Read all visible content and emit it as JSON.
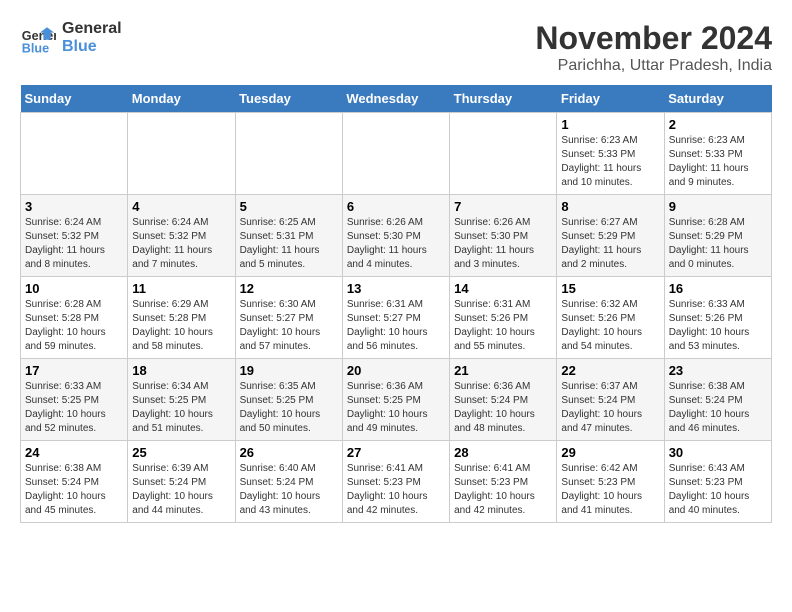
{
  "header": {
    "logo_line1": "General",
    "logo_line2": "Blue",
    "month": "November 2024",
    "location": "Parichha, Uttar Pradesh, India"
  },
  "weekdays": [
    "Sunday",
    "Monday",
    "Tuesday",
    "Wednesday",
    "Thursday",
    "Friday",
    "Saturday"
  ],
  "weeks": [
    [
      {
        "day": "",
        "info": ""
      },
      {
        "day": "",
        "info": ""
      },
      {
        "day": "",
        "info": ""
      },
      {
        "day": "",
        "info": ""
      },
      {
        "day": "",
        "info": ""
      },
      {
        "day": "1",
        "info": "Sunrise: 6:23 AM\nSunset: 5:33 PM\nDaylight: 11 hours and 10 minutes."
      },
      {
        "day": "2",
        "info": "Sunrise: 6:23 AM\nSunset: 5:33 PM\nDaylight: 11 hours and 9 minutes."
      }
    ],
    [
      {
        "day": "3",
        "info": "Sunrise: 6:24 AM\nSunset: 5:32 PM\nDaylight: 11 hours and 8 minutes."
      },
      {
        "day": "4",
        "info": "Sunrise: 6:24 AM\nSunset: 5:32 PM\nDaylight: 11 hours and 7 minutes."
      },
      {
        "day": "5",
        "info": "Sunrise: 6:25 AM\nSunset: 5:31 PM\nDaylight: 11 hours and 5 minutes."
      },
      {
        "day": "6",
        "info": "Sunrise: 6:26 AM\nSunset: 5:30 PM\nDaylight: 11 hours and 4 minutes."
      },
      {
        "day": "7",
        "info": "Sunrise: 6:26 AM\nSunset: 5:30 PM\nDaylight: 11 hours and 3 minutes."
      },
      {
        "day": "8",
        "info": "Sunrise: 6:27 AM\nSunset: 5:29 PM\nDaylight: 11 hours and 2 minutes."
      },
      {
        "day": "9",
        "info": "Sunrise: 6:28 AM\nSunset: 5:29 PM\nDaylight: 11 hours and 0 minutes."
      }
    ],
    [
      {
        "day": "10",
        "info": "Sunrise: 6:28 AM\nSunset: 5:28 PM\nDaylight: 10 hours and 59 minutes."
      },
      {
        "day": "11",
        "info": "Sunrise: 6:29 AM\nSunset: 5:28 PM\nDaylight: 10 hours and 58 minutes."
      },
      {
        "day": "12",
        "info": "Sunrise: 6:30 AM\nSunset: 5:27 PM\nDaylight: 10 hours and 57 minutes."
      },
      {
        "day": "13",
        "info": "Sunrise: 6:31 AM\nSunset: 5:27 PM\nDaylight: 10 hours and 56 minutes."
      },
      {
        "day": "14",
        "info": "Sunrise: 6:31 AM\nSunset: 5:26 PM\nDaylight: 10 hours and 55 minutes."
      },
      {
        "day": "15",
        "info": "Sunrise: 6:32 AM\nSunset: 5:26 PM\nDaylight: 10 hours and 54 minutes."
      },
      {
        "day": "16",
        "info": "Sunrise: 6:33 AM\nSunset: 5:26 PM\nDaylight: 10 hours and 53 minutes."
      }
    ],
    [
      {
        "day": "17",
        "info": "Sunrise: 6:33 AM\nSunset: 5:25 PM\nDaylight: 10 hours and 52 minutes."
      },
      {
        "day": "18",
        "info": "Sunrise: 6:34 AM\nSunset: 5:25 PM\nDaylight: 10 hours and 51 minutes."
      },
      {
        "day": "19",
        "info": "Sunrise: 6:35 AM\nSunset: 5:25 PM\nDaylight: 10 hours and 50 minutes."
      },
      {
        "day": "20",
        "info": "Sunrise: 6:36 AM\nSunset: 5:25 PM\nDaylight: 10 hours and 49 minutes."
      },
      {
        "day": "21",
        "info": "Sunrise: 6:36 AM\nSunset: 5:24 PM\nDaylight: 10 hours and 48 minutes."
      },
      {
        "day": "22",
        "info": "Sunrise: 6:37 AM\nSunset: 5:24 PM\nDaylight: 10 hours and 47 minutes."
      },
      {
        "day": "23",
        "info": "Sunrise: 6:38 AM\nSunset: 5:24 PM\nDaylight: 10 hours and 46 minutes."
      }
    ],
    [
      {
        "day": "24",
        "info": "Sunrise: 6:38 AM\nSunset: 5:24 PM\nDaylight: 10 hours and 45 minutes."
      },
      {
        "day": "25",
        "info": "Sunrise: 6:39 AM\nSunset: 5:24 PM\nDaylight: 10 hours and 44 minutes."
      },
      {
        "day": "26",
        "info": "Sunrise: 6:40 AM\nSunset: 5:24 PM\nDaylight: 10 hours and 43 minutes."
      },
      {
        "day": "27",
        "info": "Sunrise: 6:41 AM\nSunset: 5:23 PM\nDaylight: 10 hours and 42 minutes."
      },
      {
        "day": "28",
        "info": "Sunrise: 6:41 AM\nSunset: 5:23 PM\nDaylight: 10 hours and 42 minutes."
      },
      {
        "day": "29",
        "info": "Sunrise: 6:42 AM\nSunset: 5:23 PM\nDaylight: 10 hours and 41 minutes."
      },
      {
        "day": "30",
        "info": "Sunrise: 6:43 AM\nSunset: 5:23 PM\nDaylight: 10 hours and 40 minutes."
      }
    ]
  ]
}
